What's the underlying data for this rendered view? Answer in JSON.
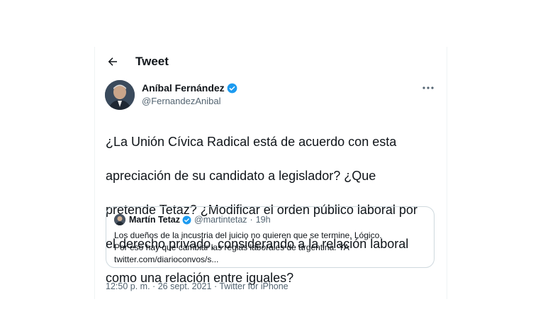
{
  "header": {
    "title": "Tweet"
  },
  "author": {
    "name": "Aníbal Fernández",
    "handle": "@FernandezAnibal"
  },
  "tweet": {
    "lines": [
      "¿La Unión Cívica Radical está de acuerdo con esta",
      "apreciación de su candidato a legislador? ¿Que",
      "pretende Tetaz? ¿Modificar el orden público laboral por",
      "el derecho privado, considerando a la relación laboral",
      "como una relación entre iguales?"
    ]
  },
  "quote": {
    "name": "Martín Tetaz",
    "handle": "@martintetaz",
    "separator": "·",
    "time": "19h",
    "lines": [
      "Los dueños de la incustria del juicio no quieren que se termine. Lógico.",
      "Por eso hay que cambiar las reglas laborales de argentina. YA",
      "twitter.com/diarioconvos/s..."
    ]
  },
  "meta": {
    "time": "12:50 p. m.",
    "separator": "·",
    "date": "26 sept. 2021",
    "source": "Twitter for iPhone"
  },
  "colors": {
    "verified": "#1d9bf0",
    "secondary_text": "#536471",
    "border": "#cfd9de"
  }
}
